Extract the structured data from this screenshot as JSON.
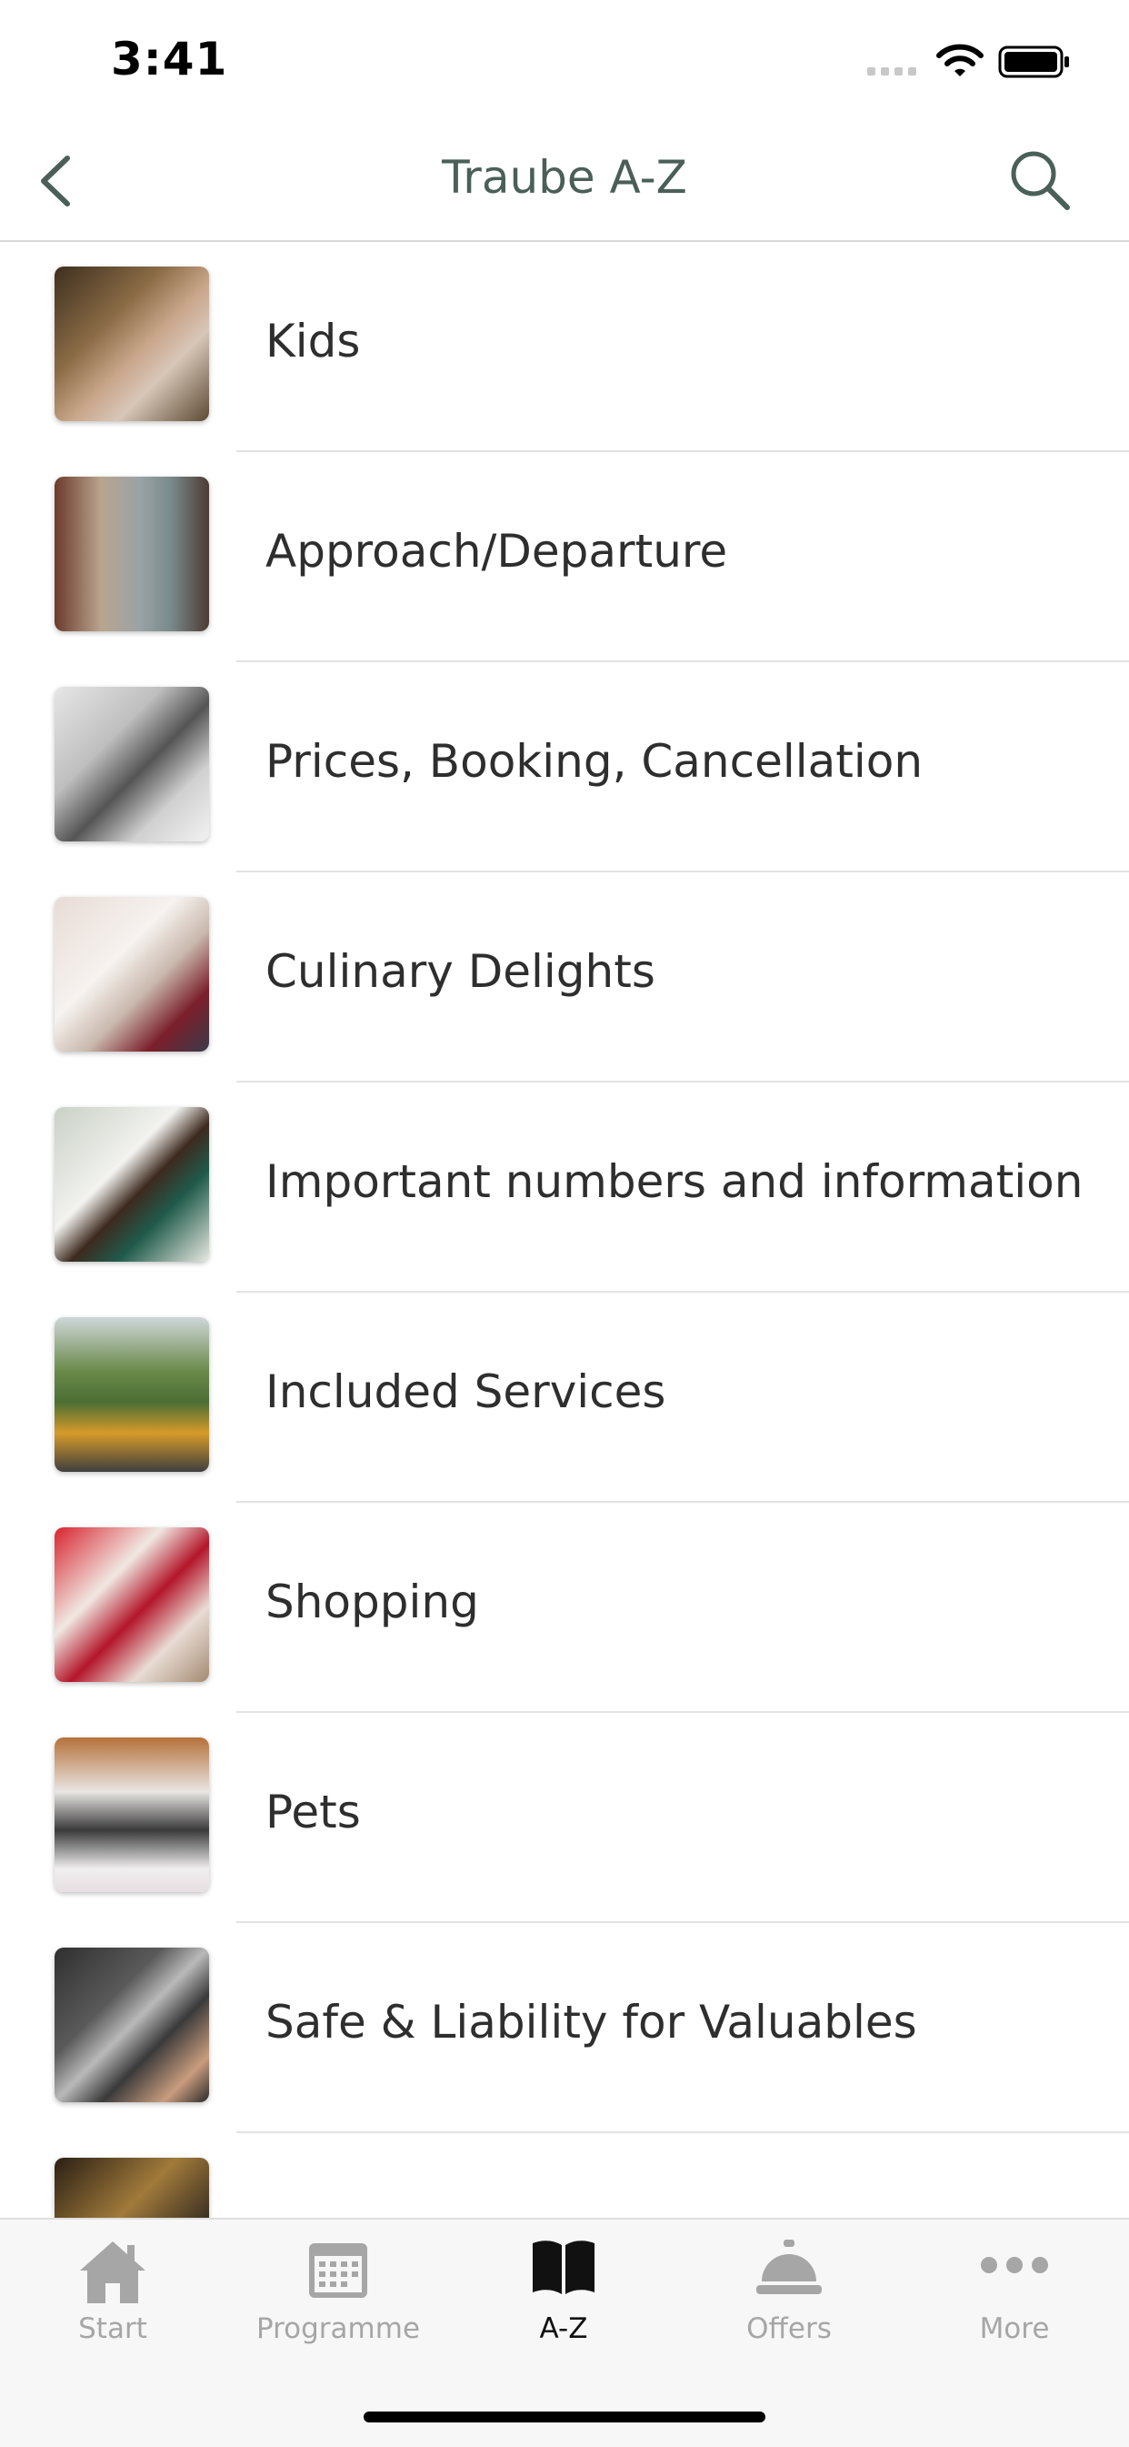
{
  "status_bar": {
    "time": "3:41"
  },
  "nav": {
    "title": "Traube A-Z"
  },
  "items": [
    {
      "label": "Kids"
    },
    {
      "label": "Approach/Departure"
    },
    {
      "label": "Prices, Booking, Cancellation"
    },
    {
      "label": "Culinary Delights"
    },
    {
      "label": "Important numbers and information"
    },
    {
      "label": "Included Services"
    },
    {
      "label": "Shopping"
    },
    {
      "label": "Pets"
    },
    {
      "label": "Safe & Liability for Valuables"
    },
    {
      "label": ""
    }
  ],
  "tabs": [
    {
      "label": "Start",
      "icon": "house-icon"
    },
    {
      "label": "Programme",
      "icon": "calendar-icon"
    },
    {
      "label": "A-Z",
      "icon": "book-icon"
    },
    {
      "label": "Offers",
      "icon": "service-bell-icon"
    },
    {
      "label": "More",
      "icon": "more-dots-icon"
    }
  ],
  "colors": {
    "accent": "#4a5f58",
    "tab_inactive": "#a6a6a6",
    "tab_active": "#111111"
  }
}
